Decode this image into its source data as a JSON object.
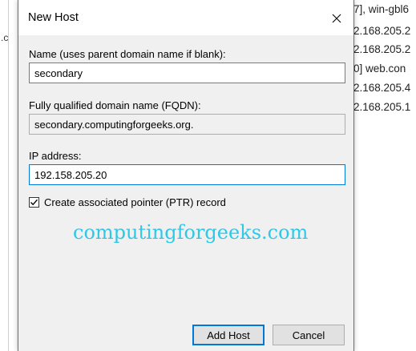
{
  "background": {
    "left_fragment": ".c",
    "lines": [
      "7], win-gbl6",
      "2.168.205.2",
      "2.168.205.2",
      "0]  web.con",
      "2.168.205.4",
      "2.168.205.1"
    ]
  },
  "dialog": {
    "title": "New Host",
    "close_glyph": "✕",
    "name_label": "Name (uses parent domain name if blank):",
    "name_value": "secondary",
    "fqdn_label": "Fully qualified domain name (FQDN):",
    "fqdn_value": "secondary.computingforgeeks.org.",
    "ip_label": "IP address:",
    "ip_value": "192.158.205.20",
    "ptr_label": "Create associated pointer (PTR) record",
    "ptr_checked": true,
    "add_host_label": "Add Host",
    "cancel_label": "Cancel"
  },
  "watermark": "computingforgeeks.com",
  "colors": {
    "focus": "#0078d7",
    "watermark": "#2ec8e6",
    "dialog_bg": "#f0f0f0"
  }
}
